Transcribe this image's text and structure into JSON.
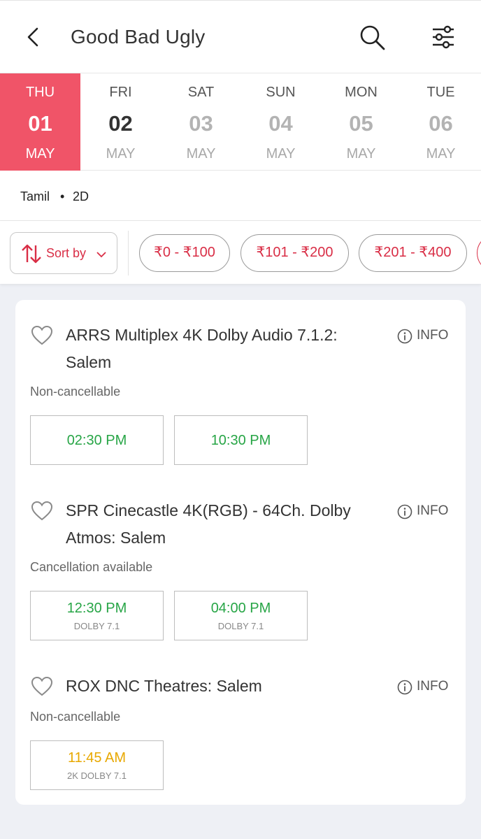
{
  "header": {
    "title": "Good Bad Ugly"
  },
  "dates": [
    {
      "dow": "THU",
      "day": "01",
      "month": "MAY",
      "state": "selected"
    },
    {
      "dow": "FRI",
      "day": "02",
      "month": "MAY",
      "state": "available"
    },
    {
      "dow": "SAT",
      "day": "03",
      "month": "MAY",
      "state": "disabled"
    },
    {
      "dow": "SUN",
      "day": "04",
      "month": "MAY",
      "state": "disabled"
    },
    {
      "dow": "MON",
      "day": "05",
      "month": "MAY",
      "state": "disabled"
    },
    {
      "dow": "TUE",
      "day": "06",
      "month": "MAY",
      "state": "disabled"
    }
  ],
  "format": {
    "language": "Tamil",
    "separator": "•",
    "dimension": "2D"
  },
  "filters": {
    "sort_label": "Sort by",
    "price_ranges": [
      "₹0 - ₹100",
      "₹101 - ₹200",
      "₹201 - ₹400"
    ]
  },
  "venues": [
    {
      "name": "ARRS Multiplex 4K Dolby Audio 7.1.2: Salem",
      "info_label": "INFO",
      "cancellation": "Non-cancellable",
      "showtimes": [
        {
          "time": "02:30 PM",
          "format": "",
          "status": "available"
        },
        {
          "time": "10:30 PM",
          "format": "",
          "status": "available"
        }
      ]
    },
    {
      "name": "SPR Cinecastle 4K(RGB) - 64Ch. Dolby Atmos: Salem",
      "info_label": "INFO",
      "cancellation": "Cancellation available",
      "showtimes": [
        {
          "time": "12:30 PM",
          "format": "DOLBY 7.1",
          "status": "available"
        },
        {
          "time": "04:00 PM",
          "format": "DOLBY 7.1",
          "status": "available"
        }
      ]
    },
    {
      "name": "ROX DNC Theatres: Salem",
      "info_label": "INFO",
      "cancellation": "Non-cancellable",
      "showtimes": [
        {
          "time": "11:45 AM",
          "format": "2K DOLBY 7.1",
          "status": "filling-fast"
        }
      ]
    }
  ],
  "colors": {
    "accent": "#f05468",
    "brand_red": "#d92e46",
    "available_green": "#27a546",
    "filling_amber": "#e8a800"
  },
  "icons": {
    "back": "back-arrow-icon",
    "search": "search-icon",
    "filter": "filter-sliders-icon",
    "sort": "sort-arrows-icon",
    "favorite": "heart-icon",
    "info": "info-icon"
  }
}
